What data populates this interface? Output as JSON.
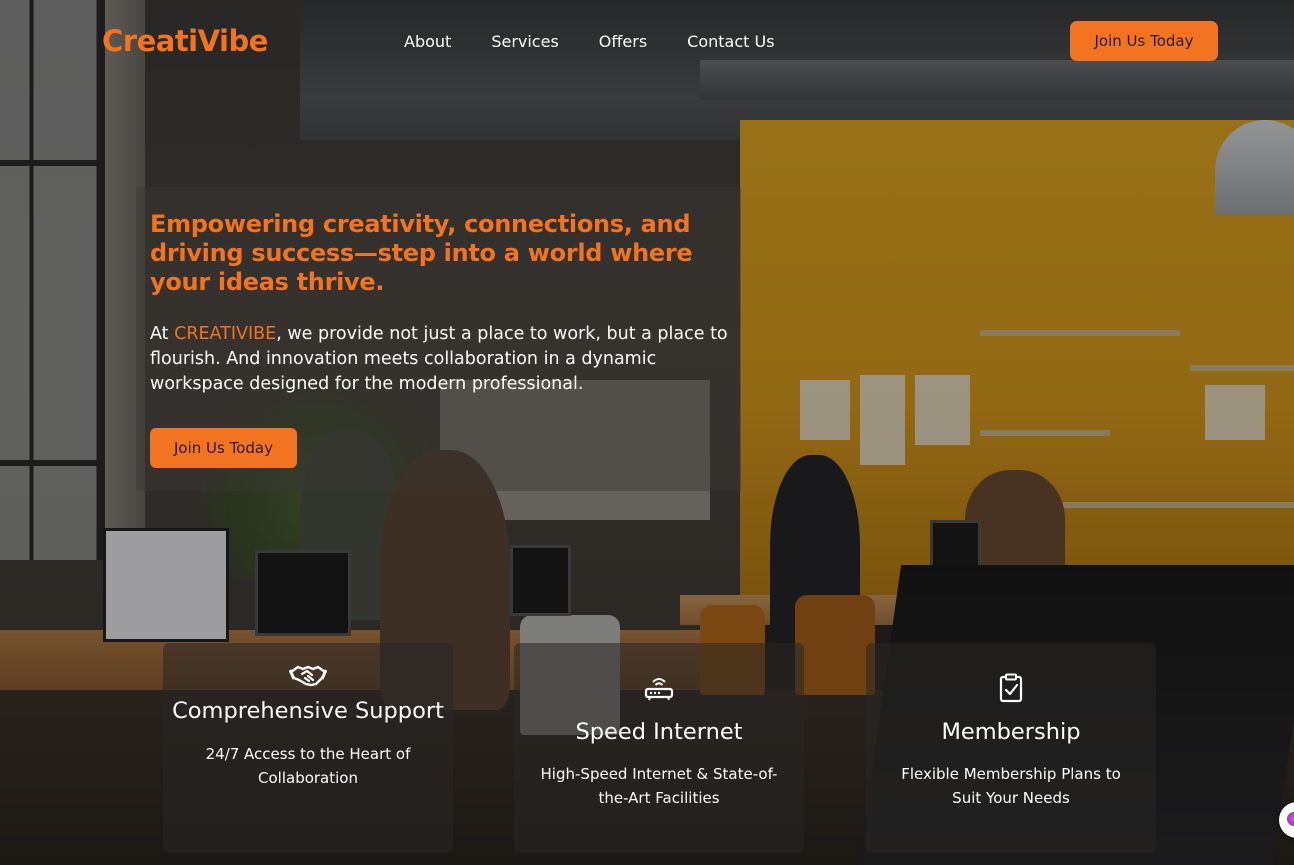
{
  "brand": {
    "logo_text": "CreatiVibe",
    "accent_color": "#f27320"
  },
  "nav": {
    "items": [
      {
        "label": "About"
      },
      {
        "label": "Services"
      },
      {
        "label": "Offers"
      },
      {
        "label": "Contact Us"
      }
    ],
    "cta_label": "Join Us Today"
  },
  "hero": {
    "title": "Empowering creativity, connections, and driving success—step into a world where your ideas thrive.",
    "text_prefix": "At ",
    "text_brand": "CREATIVIBE",
    "text_suffix": ", we provide not just a place to work, but a place to flourish. And innovation meets collaboration in a dynamic workspace designed for the modern professional.",
    "cta_label": "Join Us Today"
  },
  "features": [
    {
      "icon": "handshake-icon",
      "title": "Comprehensive Support",
      "description": "24/7 Access to the Heart of Collaboration"
    },
    {
      "icon": "router-icon",
      "title": "Speed Internet",
      "description": "High-Speed Internet & State-of-the-Art Facilities"
    },
    {
      "icon": "clipboard-check-icon",
      "title": "Membership",
      "description": "Flexible Membership Plans to Suit Your Needs"
    }
  ],
  "chat_widget": {
    "icon": "chat-bubble-icon"
  }
}
